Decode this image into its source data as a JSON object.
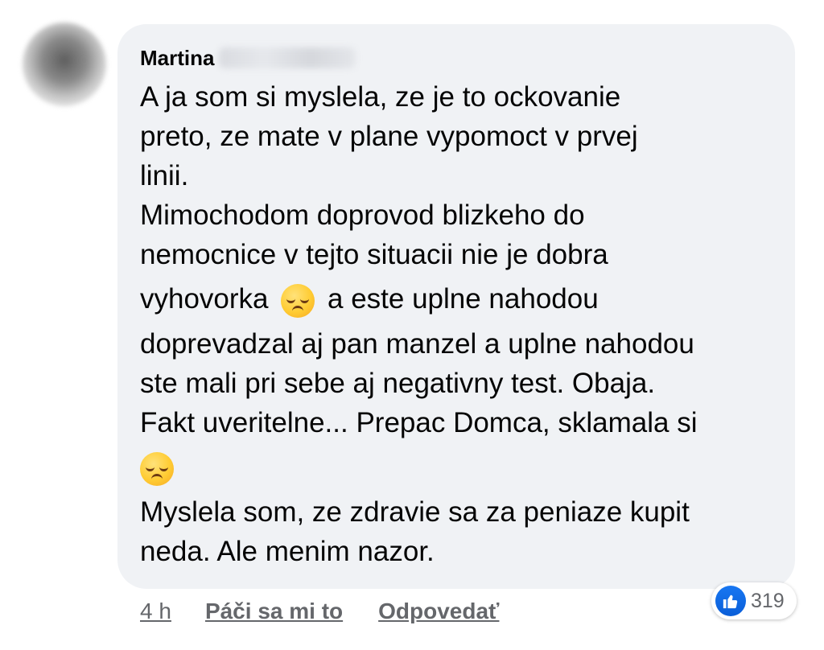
{
  "comment": {
    "author_first_name": "Martina",
    "lines": [
      "A ja som si myslela, ze je to ockovanie",
      "preto, ze mate v plane vypomoct v prvej",
      "linii.",
      "Mimochodom doprovod blizkeho do",
      "nemocnice v tejto situacii nie je dobra",
      "vyhovorka",
      "a este uplne nahodou",
      "doprevadzal aj pan manzel a uplne nahodou",
      "ste mali pri sebe aj negativny test. Obaja.",
      "Fakt uveritelne... Prepac Domca, sklamala si",
      "Myslela som, ze zdravie sa za peniaze kupit",
      "neda. Ale menim nazor."
    ],
    "emoji": "disappointed-face"
  },
  "actions": {
    "time": "4 h",
    "like_label": "Páči sa mi to",
    "reply_label": "Odpovedať"
  },
  "reactions": {
    "icon": "like-icon",
    "count": "319",
    "color": "#1877f2"
  }
}
